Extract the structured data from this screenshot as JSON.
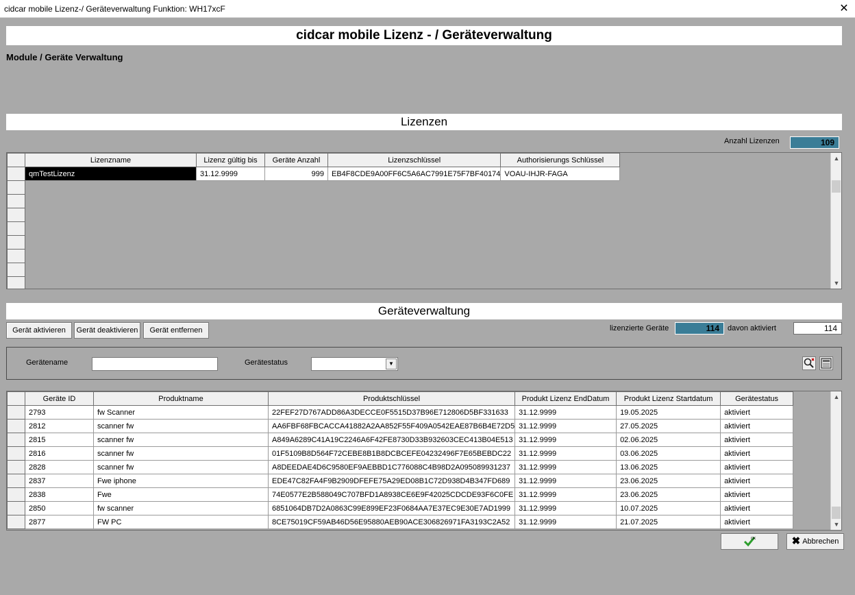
{
  "window": {
    "title": "cidcar mobile Lizenz-/ Geräteverwaltung Funktion: WH17xcF",
    "close_glyph": "✕"
  },
  "header": {
    "title": "cidcar mobile Lizenz - / Geräteverwaltung",
    "subtitle": "Module / Geräte Verwaltung"
  },
  "licenses": {
    "section_title": "Lizenzen",
    "count_label": "Anzahl Lizenzen",
    "count_value": "109",
    "columns": [
      "Lizenzname",
      "Lizenz gültig bis",
      "Geräte Anzahl",
      "Lizenzschlüssel",
      "Authorisierungs Schlüssel"
    ],
    "rows": [
      [
        "qmTestLizenz",
        "31.12.9999",
        "999",
        "EB4F8CDE9A00FF6C5A6AC7991E75F7BF40174",
        "VOAU-IHJR-FAGA"
      ]
    ]
  },
  "devices": {
    "section_title": "Geräteverwaltung",
    "btn_activate": "Gerät aktivieren",
    "btn_deactivate": "Gerät deaktivieren",
    "btn_remove": "Gerät entfernen",
    "licensed_label": "lizenzierte Geräte",
    "licensed_value": "114",
    "activated_label": "davon aktiviert",
    "activated_value": "114",
    "filter": {
      "name_label": "Gerätename",
      "name_value": "",
      "status_label": "Gerätestatus",
      "status_value": ""
    },
    "columns": [
      "Geräte ID",
      "Produktname",
      "Produktschlüssel",
      "Produkt Lizenz EndDatum",
      "Produkt Lizenz Startdatum",
      "Gerätestatus"
    ],
    "rows": [
      [
        "2793",
        "fw Scanner",
        "22FEF27D767ADD86A3DECCE0F5515D37B96E712806D5BF331633",
        "31.12.9999",
        "19.05.2025",
        "aktiviert"
      ],
      [
        "2812",
        "scanner fw",
        "AA6FBF68FBCACCA41882A2AA852F55F409A0542EAE87B6B4E72D5",
        "31.12.9999",
        "27.05.2025",
        "aktiviert"
      ],
      [
        "2815",
        "scanner fw",
        "A849A6289C41A19C2246A6F42FE8730D33B932603CEC413B04E513",
        "31.12.9999",
        "02.06.2025",
        "aktiviert"
      ],
      [
        "2816",
        "scanner fw",
        "01F5109B8D564F72CEBE8B1B8DCBCEFE04232496F7E65BEBDC22",
        "31.12.9999",
        "03.06.2025",
        "aktiviert"
      ],
      [
        "2828",
        "scanner fw",
        "A8DEEDAE4D6C9580EF9AEBBD1C776088C4B98D2A095089931237",
        "31.12.9999",
        "13.06.2025",
        "aktiviert"
      ],
      [
        "2837",
        "Fwe iphone",
        "EDE47C82FA4F9B2909DFEFE75A29ED08B1C72D938D4B347FD689",
        "31.12.9999",
        "23.06.2025",
        "aktiviert"
      ],
      [
        "2838",
        "Fwe",
        "74E0577E2B588049C707BFD1A8938CE6E9F42025CDCDE93F6C0FE",
        "31.12.9999",
        "23.06.2025",
        "aktiviert"
      ],
      [
        "2850",
        "fw scanner",
        "6851064DB7D2A0863C99E899EF23F0684AA7E37EC9E30E7AD1999",
        "31.12.9999",
        "10.07.2025",
        "aktiviert"
      ],
      [
        "2877",
        "FW PC",
        "8CE75019CF59AB46D56E95880AEB90ACE306826971FA3193C2A52",
        "31.12.9999",
        "21.07.2025",
        "aktiviert"
      ]
    ]
  },
  "footer": {
    "ok_label": "OK",
    "cancel_label": "Abbrechen"
  },
  "icons": {
    "ok": "checkmark-icon",
    "cancel": "x-icon",
    "search": "magnifier-icon",
    "clear": "grid-icon"
  },
  "colors": {
    "count_box": "#3a7d97",
    "background": "#a9a9a9"
  }
}
